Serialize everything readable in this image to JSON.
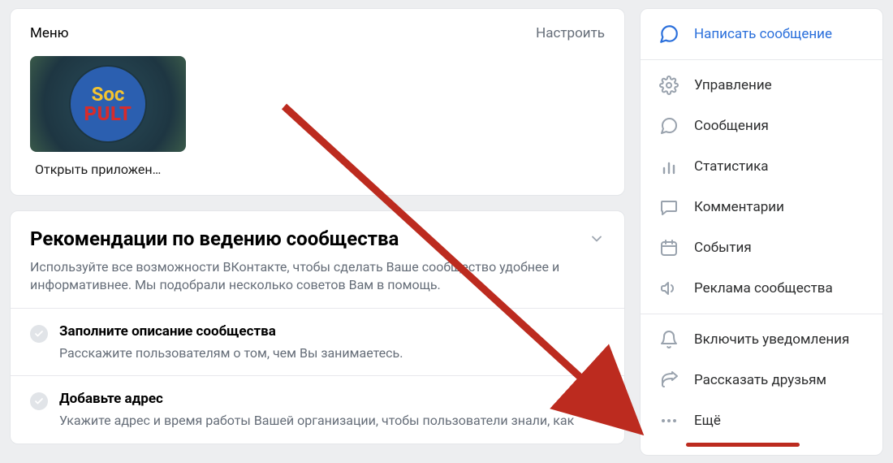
{
  "menu": {
    "title": "Меню",
    "settings": "Настроить",
    "app": {
      "logo_line1": "Soc",
      "logo_line2": "PULT",
      "caption": "Открыть приложен…"
    }
  },
  "recommendations": {
    "title": "Рекомендации по ведению сообщества",
    "subtitle": "Используйте все возможности ВКонтакте, чтобы сделать Ваше сообщество удобнее и информативнее. Мы подобрали несколько советов Вам в помощь.",
    "items": [
      {
        "title": "Заполните описание сообщества",
        "subtitle": "Расскажите пользователям о том, чем Вы занимаетесь."
      },
      {
        "title": "Добавьте адрес",
        "subtitle": "Укажите адрес и время работы Вашей организации, чтобы пользователи знали, как"
      }
    ]
  },
  "sidebar": {
    "primary": {
      "label": "Написать сообщение",
      "icon": "message-bubble-icon"
    },
    "group_manage": [
      {
        "label": "Управление",
        "icon": "gear-icon"
      },
      {
        "label": "Сообщения",
        "icon": "chat-icon"
      },
      {
        "label": "Статистика",
        "icon": "stats-icon"
      },
      {
        "label": "Комментарии",
        "icon": "comment-icon"
      },
      {
        "label": "События",
        "icon": "calendar-icon"
      },
      {
        "label": "Реклама сообщества",
        "icon": "megaphone-icon"
      }
    ],
    "group_actions": [
      {
        "label": "Включить уведомления",
        "icon": "bell-icon"
      },
      {
        "label": "Рассказать друзьям",
        "icon": "share-icon"
      },
      {
        "label": "Ещё",
        "icon": "more-icon"
      }
    ]
  }
}
